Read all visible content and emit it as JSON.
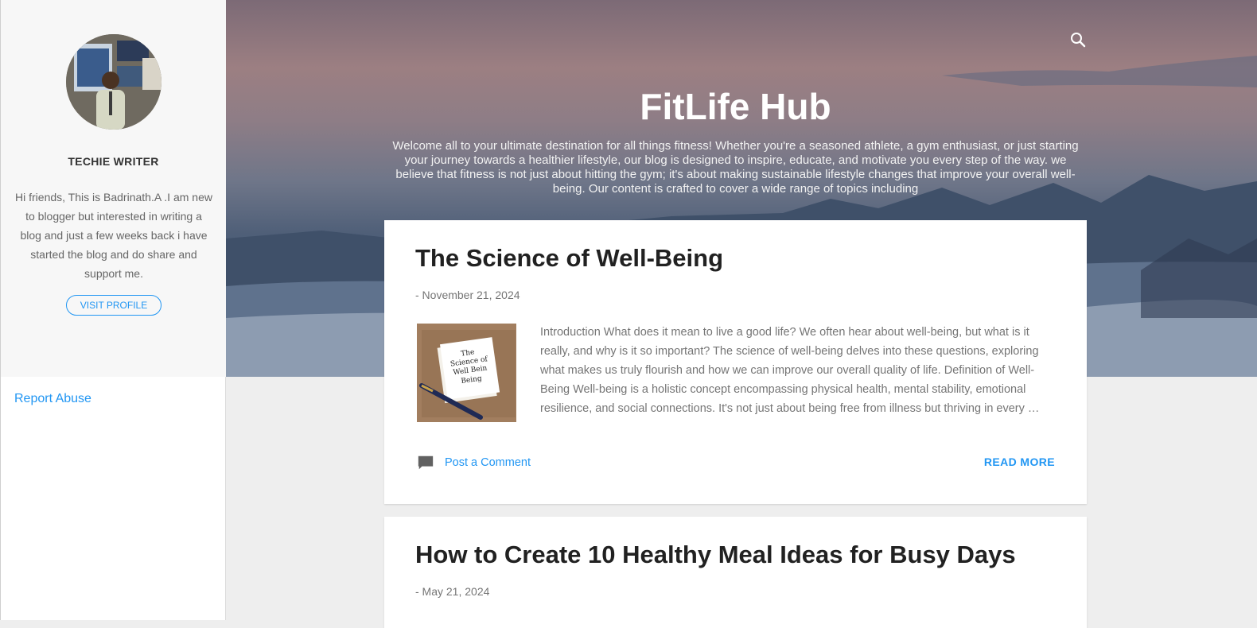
{
  "sidebar": {
    "author_name": "TECHIE WRITER",
    "author_bio": "Hi friends, This is Badrinath.A .I am new to blogger but interested in writing a blog and just a few weeks back i have started the blog and do share and support me.",
    "visit_profile": "VISIT PROFILE",
    "report_abuse": "Report Abuse"
  },
  "header": {
    "title": "FitLife Hub",
    "description": "Welcome all to your ultimate destination for all things fitness! Whether you're a seasoned athlete, a gym enthusiast, or just starting your journey towards a healthier lifestyle, our blog is designed to inspire, educate, and motivate you every step of the way. we believe that fitness is not just about hitting the gym; it's about making sustainable lifestyle changes that improve your overall well-being. Our content is crafted to cover a wide range of topics including",
    "search_icon": "search-icon"
  },
  "posts": [
    {
      "title": "The Science of Well-Being",
      "date": "- November 21, 2024",
      "thumbnail_text": "The Science of Well Being",
      "snippet": "Introduction What does it mean to live a good life? We often hear about well-being, but what is it really, and why is it so important? The science of well-being delves into these questions, exploring what makes us truly flourish and how we can improve our overall quality of life. Definition of Well-Being      Well-being is a holistic concept encompassing physical health, mental stability, emotional resilience, and social connections. It's not just about being free from illness but thriving in every …",
      "comment_label": "Post a Comment",
      "read_more": "READ MORE"
    },
    {
      "title": "How to Create 10 Healthy Meal Ideas for Busy Days",
      "date": "- May 21, 2024"
    }
  ],
  "colors": {
    "accent": "#2196f3",
    "title_text": "#212121",
    "muted_text": "#757575"
  }
}
